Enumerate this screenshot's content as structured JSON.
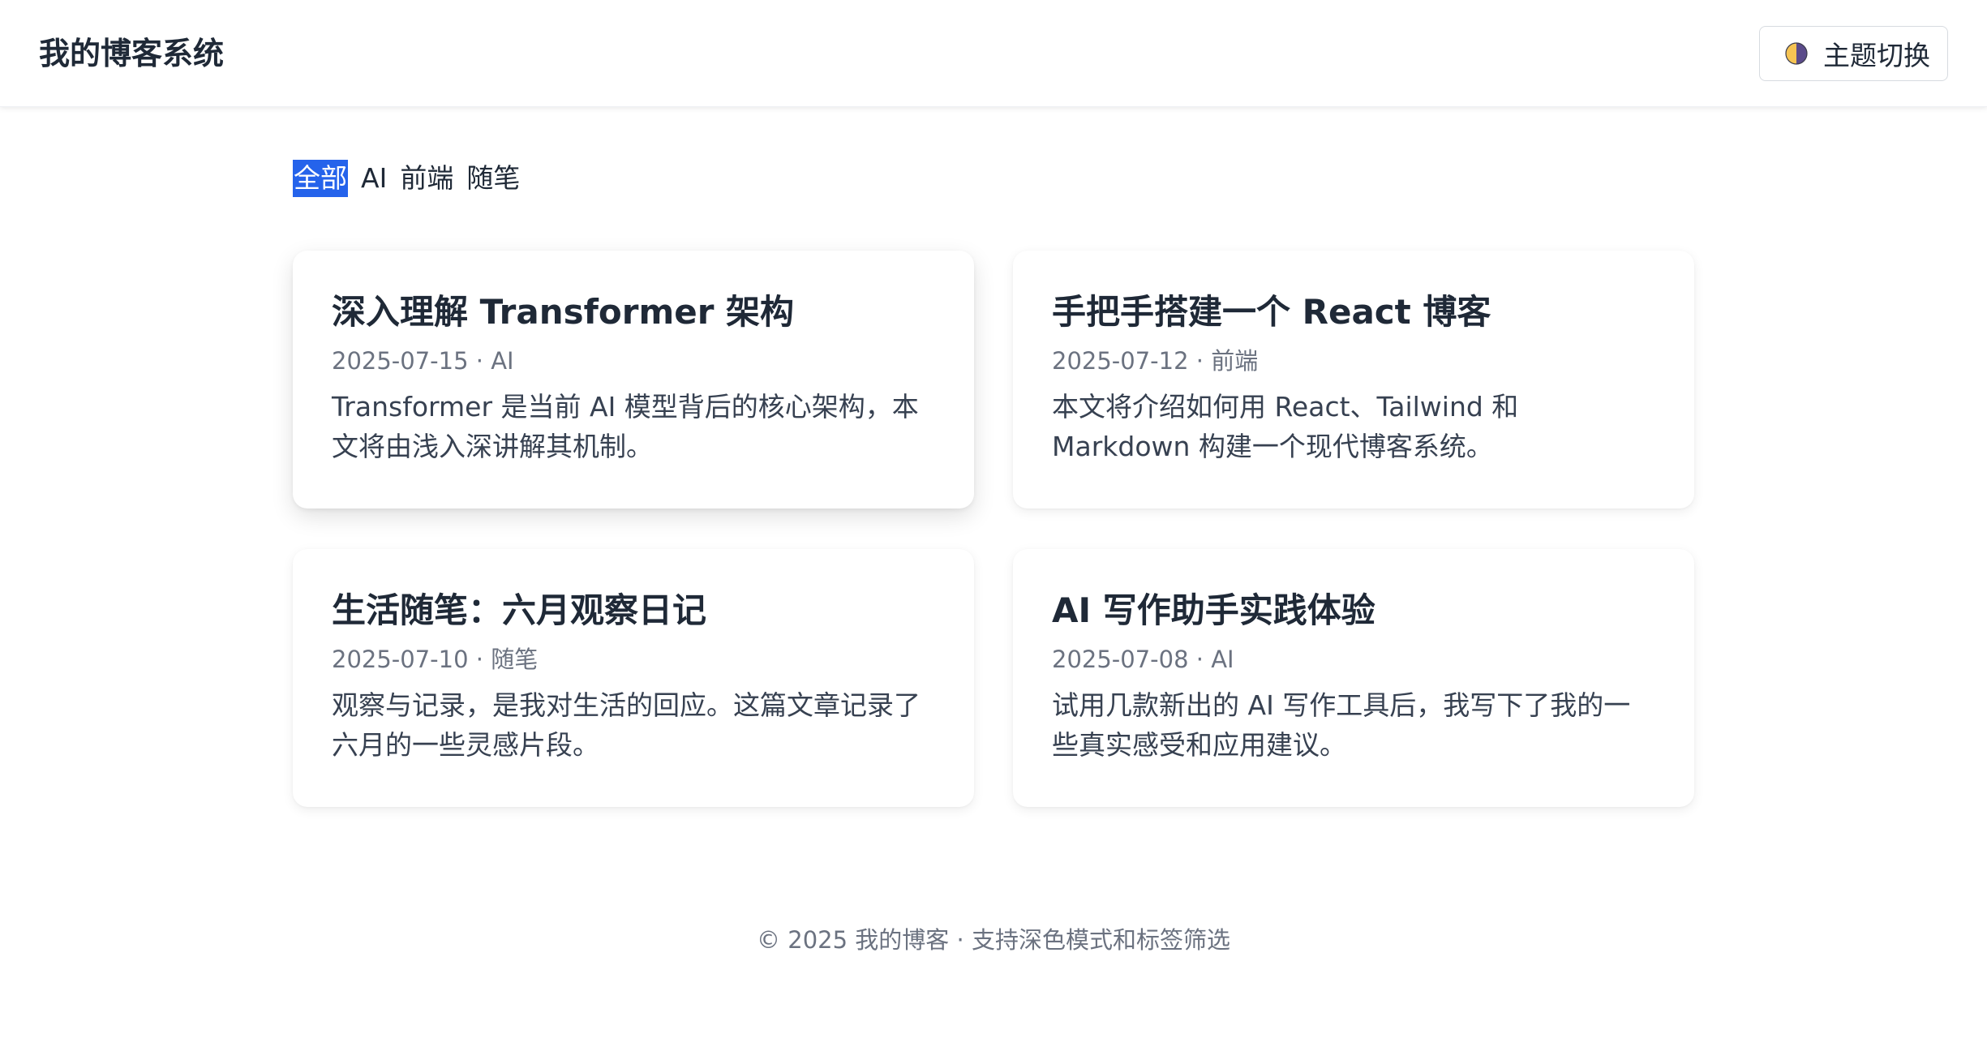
{
  "header": {
    "title": "我的博客系统",
    "theme_button": {
      "label": "主题切换",
      "icon": "half-moon-theme-icon"
    }
  },
  "filters": [
    {
      "label": "全部",
      "active": true
    },
    {
      "label": "AI",
      "active": false
    },
    {
      "label": "前端",
      "active": false
    },
    {
      "label": "随笔",
      "active": false
    }
  ],
  "posts": [
    {
      "title": "深入理解 Transformer 架构",
      "date": "2025-07-15",
      "separator": "·",
      "tag": "AI",
      "excerpt": "Transformer 是当前 AI 模型背后的核心架构，本文将由浅入深讲解其机制。"
    },
    {
      "title": "手把手搭建一个 React 博客",
      "date": "2025-07-12",
      "separator": "·",
      "tag": "前端",
      "excerpt": "本文将介绍如何用 React、Tailwind 和 Markdown 构建一个现代博客系统。"
    },
    {
      "title": "生活随笔：六月观察日记",
      "date": "2025-07-10",
      "separator": "·",
      "tag": "随笔",
      "excerpt": "观察与记录，是我对生活的回应。这篇文章记录了六月的一些灵感片段。"
    },
    {
      "title": "AI 写作助手实践体验",
      "date": "2025-07-08",
      "separator": "·",
      "tag": "AI",
      "excerpt": "试用几款新出的 AI 写作工具后，我写下了我的一些真实感受和应用建议。"
    }
  ],
  "footer": {
    "text": "© 2025 我的博客 · 支持深色模式和标签筛选"
  },
  "colors": {
    "accent": "#2563eb",
    "text": "#1f2937",
    "muted": "#6b7280",
    "theme_icon_light": "#f6c453",
    "theme_icon_dark": "#5b4b8a"
  }
}
